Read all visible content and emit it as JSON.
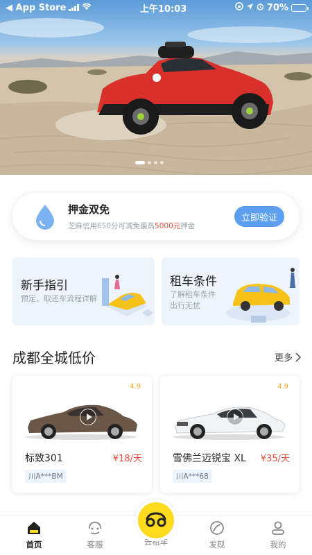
{
  "status_bar": {
    "back_app": "◀ App Store",
    "time": "上午10:03",
    "battery": "70%",
    "battery_level": 0.7
  },
  "banner": {
    "image_desc": "red off-road sports car on desert sand",
    "slide_count": 4,
    "active_slide": 0
  },
  "deposit": {
    "title": "押金双免",
    "desc_prefix": "芝麻信用650分可减免最高",
    "desc_highlight": "5000元",
    "desc_suffix": "押金",
    "button": "立即验证",
    "icon": "water-drop-icon"
  },
  "guides": [
    {
      "title": "新手指引",
      "sub1": "预定、取还车流程详解",
      "sub2": ""
    },
    {
      "title": "租车条件",
      "sub1": "了解租车条件",
      "sub2": "出行无忧"
    }
  ],
  "section": {
    "title": "成都全城低价",
    "more": "更多"
  },
  "cars": [
    {
      "name": "标致301",
      "price": "¥18/天",
      "rating": "4.9",
      "plate": "川A***BM",
      "color": "#6b5647"
    },
    {
      "name": "雪佛兰迈锐宝 XL",
      "price": "¥35/天",
      "rating": "4.9",
      "plate": "川A***68",
      "color": "#f2f3f5"
    }
  ],
  "tabbar": {
    "items": [
      {
        "label": "首页",
        "icon": "home-icon"
      },
      {
        "label": "客服",
        "icon": "service-icon"
      },
      {
        "label": "去租车",
        "icon": "rent-car-icon"
      },
      {
        "label": "发现",
        "icon": "discover-icon"
      },
      {
        "label": "我的",
        "icon": "profile-icon"
      }
    ],
    "active": 0
  },
  "colors": {
    "accent": "#5b9ff0",
    "price": "#f0503c",
    "rating": "#f5a623",
    "brand_yellow": "#fedb1e"
  }
}
